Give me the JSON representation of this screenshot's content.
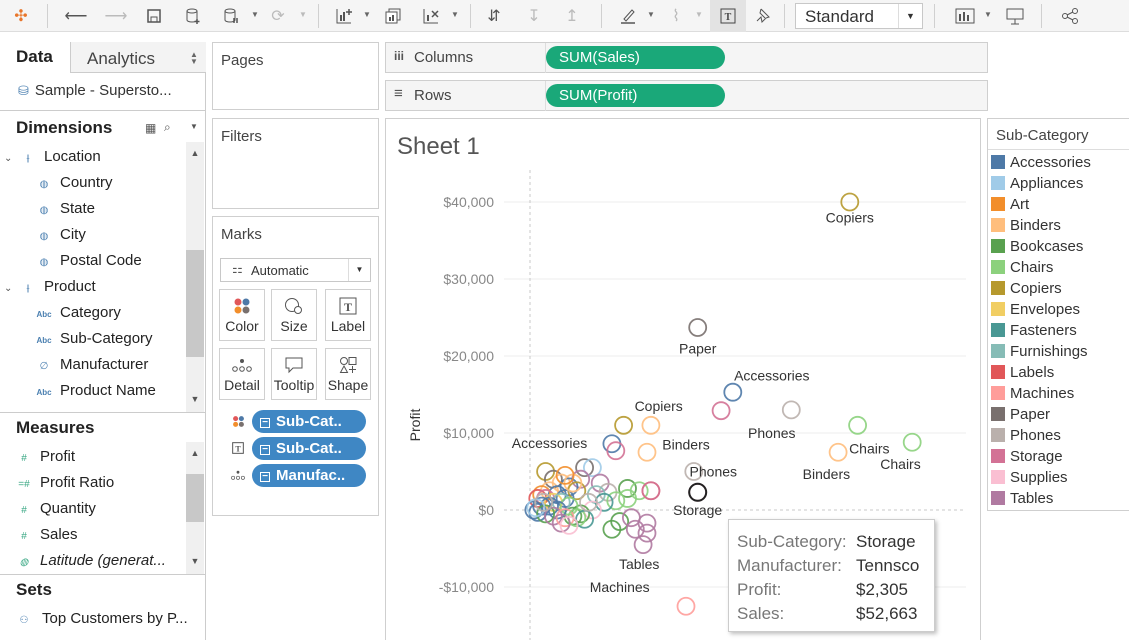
{
  "toolbar": {
    "view_mode": "Standard"
  },
  "left_panel": {
    "tabs": [
      {
        "label": "Data"
      },
      {
        "label": "Analytics"
      }
    ],
    "datasource": "Sample - Supersto...",
    "dimensions_title": "Dimensions",
    "dimensions": [
      {
        "label": "Location",
        "kind": "group"
      },
      {
        "label": "Country",
        "kind": "geo"
      },
      {
        "label": "State",
        "kind": "geo"
      },
      {
        "label": "City",
        "kind": "geo"
      },
      {
        "label": "Postal Code",
        "kind": "geo"
      },
      {
        "label": "Product",
        "kind": "group"
      },
      {
        "label": "Category",
        "kind": "abc"
      },
      {
        "label": "Sub-Category",
        "kind": "abc"
      },
      {
        "label": "Manufacturer",
        "kind": "link"
      },
      {
        "label": "Product Name",
        "kind": "abc"
      }
    ],
    "measures_title": "Measures",
    "measures": [
      {
        "label": "Profit"
      },
      {
        "label": "Profit Ratio"
      },
      {
        "label": "Quantity"
      },
      {
        "label": "Sales"
      },
      {
        "label": "Latitude (generat..."
      }
    ],
    "sets_title": "Sets",
    "sets": [
      {
        "label": "Top Customers by P..."
      }
    ]
  },
  "shelves": {
    "pages": "Pages",
    "filters": "Filters",
    "columns_label": "Columns",
    "columns_pill": "SUM(Sales)",
    "rows_label": "Rows",
    "rows_pill": "SUM(Profit)"
  },
  "marks": {
    "title": "Marks",
    "type": "Automatic",
    "buttons": [
      "Color",
      "Size",
      "Label",
      "Detail",
      "Tooltip",
      "Shape"
    ],
    "pills": [
      "Sub-Cat..",
      "Sub-Cat..",
      "Manufac.."
    ]
  },
  "sheet": {
    "title": "Sheet 1"
  },
  "legend": {
    "title": "Sub-Category",
    "items": [
      {
        "label": "Accessories",
        "color": "#4e79a7"
      },
      {
        "label": "Appliances",
        "color": "#a0cbe8"
      },
      {
        "label": "Art",
        "color": "#f28e2b"
      },
      {
        "label": "Binders",
        "color": "#ffbe7d"
      },
      {
        "label": "Bookcases",
        "color": "#59a14f"
      },
      {
        "label": "Chairs",
        "color": "#8cd17d"
      },
      {
        "label": "Copiers",
        "color": "#b6992d"
      },
      {
        "label": "Envelopes",
        "color": "#f1ce63"
      },
      {
        "label": "Fasteners",
        "color": "#499894"
      },
      {
        "label": "Furnishings",
        "color": "#86bcb6"
      },
      {
        "label": "Labels",
        "color": "#e15759"
      },
      {
        "label": "Machines",
        "color": "#ff9d9a"
      },
      {
        "label": "Paper",
        "color": "#79706e"
      },
      {
        "label": "Phones",
        "color": "#bab0ac"
      },
      {
        "label": "Storage",
        "color": "#d37295"
      },
      {
        "label": "Supplies",
        "color": "#fabfd2"
      },
      {
        "label": "Tables",
        "color": "#b07aa1"
      }
    ]
  },
  "tooltip": {
    "rows": [
      {
        "key": "Sub-Category:",
        "value": "Storage"
      },
      {
        "key": "Manufacturer:",
        "value": "Tennsco"
      },
      {
        "key": "Profit:",
        "value": "$2,305"
      },
      {
        "key": "Sales:",
        "value": "$52,663"
      }
    ]
  },
  "chart_data": {
    "type": "scatter",
    "title": "Sheet 1",
    "xlabel": "",
    "ylabel": "Profit",
    "ylim": [
      -15000,
      42000
    ],
    "y_ticks": [
      "$40,000",
      "$30,000",
      "$20,000",
      "$10,000",
      "$0",
      "-$10,000"
    ],
    "y_tick_values": [
      40000,
      30000,
      20000,
      10000,
      0,
      -10000
    ],
    "annotations": [
      {
        "text": "Copiers",
        "x": 82000,
        "y": 38000
      },
      {
        "text": "Paper",
        "x": 43000,
        "y": 21000
      },
      {
        "text": "Accessories",
        "x": 62000,
        "y": 17500
      },
      {
        "text": "Copiers",
        "x": 33000,
        "y": 13500
      },
      {
        "text": "Phones",
        "x": 62000,
        "y": 10000
      },
      {
        "text": "Chairs",
        "x": 87000,
        "y": 8000
      },
      {
        "text": "Accessories",
        "x": 5000,
        "y": 8700
      },
      {
        "text": "Binders",
        "x": 40000,
        "y": 8500
      },
      {
        "text": "Phones",
        "x": 47000,
        "y": 5000
      },
      {
        "text": "Binders",
        "x": 76000,
        "y": 4700
      },
      {
        "text": "Chairs",
        "x": 95000,
        "y": 6000
      },
      {
        "text": "Storage",
        "x": 43000,
        "y": 0
      },
      {
        "text": "Tables",
        "x": 28000,
        "y": -7000
      },
      {
        "text": "Machines",
        "x": 23000,
        "y": -10000
      }
    ],
    "points": [
      {
        "x": 82000,
        "y": 40000,
        "cat": "Copiers"
      },
      {
        "x": 43000,
        "y": 23700,
        "cat": "Paper"
      },
      {
        "x": 52000,
        "y": 15300,
        "cat": "Accessories"
      },
      {
        "x": 49000,
        "y": 12900,
        "cat": "Storage"
      },
      {
        "x": 67000,
        "y": 13000,
        "cat": "Phones"
      },
      {
        "x": 84000,
        "y": 11000,
        "cat": "Chairs"
      },
      {
        "x": 98000,
        "y": 8800,
        "cat": "Chairs"
      },
      {
        "x": 79000,
        "y": 7500,
        "cat": "Binders"
      },
      {
        "x": 24000,
        "y": 11000,
        "cat": "Copiers"
      },
      {
        "x": 31000,
        "y": 11000,
        "cat": "Binders"
      },
      {
        "x": 21000,
        "y": 8600,
        "cat": "Accessories"
      },
      {
        "x": 22000,
        "y": 7700,
        "cat": "Storage"
      },
      {
        "x": 30000,
        "y": 7500,
        "cat": "Binders"
      },
      {
        "x": 42000,
        "y": 5000,
        "cat": "Phones"
      },
      {
        "x": 43000,
        "y": 2300,
        "cat": "Storage"
      },
      {
        "x": 14000,
        "y": 5500,
        "cat": "Paper"
      },
      {
        "x": 16000,
        "y": 5500,
        "cat": "Appliances"
      },
      {
        "x": 13000,
        "y": 4000,
        "cat": "Tables"
      },
      {
        "x": 18000,
        "y": 3500,
        "cat": "Tables"
      },
      {
        "x": 25000,
        "y": 2800,
        "cat": "Bookcases"
      },
      {
        "x": 28000,
        "y": 2500,
        "cat": "Chairs"
      },
      {
        "x": 31000,
        "y": 2500,
        "cat": "Labels"
      },
      {
        "x": 31000,
        "y": 2500,
        "cat": "Storage"
      },
      {
        "x": 20000,
        "y": 2300,
        "cat": "Phones"
      },
      {
        "x": 17000,
        "y": 2000,
        "cat": "Furnishings"
      },
      {
        "x": 22000,
        "y": 1200,
        "cat": "Chairs"
      },
      {
        "x": 25000,
        "y": 1500,
        "cat": "Chairs"
      },
      {
        "x": 19000,
        "y": 1000,
        "cat": "Fasteners"
      },
      {
        "x": 16000,
        "y": 0,
        "cat": "Supplies"
      },
      {
        "x": 13000,
        "y": -500,
        "cat": "Bookcases"
      },
      {
        "x": 11000,
        "y": -800,
        "cat": "Bookcases"
      },
      {
        "x": 23000,
        "y": -1500,
        "cat": "Bookcases"
      },
      {
        "x": 26000,
        "y": -1000,
        "cat": "Tables"
      },
      {
        "x": 27000,
        "y": -2500,
        "cat": "Tables"
      },
      {
        "x": 30000,
        "y": -3000,
        "cat": "Tables"
      },
      {
        "x": 30000,
        "y": -1700,
        "cat": "Tables"
      },
      {
        "x": 29000,
        "y": -4500,
        "cat": "Tables"
      },
      {
        "x": 21000,
        "y": -2500,
        "cat": "Bookcases"
      },
      {
        "x": 40000,
        "y": -12500,
        "cat": "Machines"
      },
      {
        "x": 4000,
        "y": 5000,
        "cat": "Copiers"
      },
      {
        "x": 6000,
        "y": 4000,
        "cat": "Paper"
      },
      {
        "x": 8000,
        "y": 3500,
        "cat": "Binders"
      },
      {
        "x": 10000,
        "y": 3000,
        "cat": "Accessories"
      },
      {
        "x": 12000,
        "y": 2500,
        "cat": "Copiers"
      },
      {
        "x": 5000,
        "y": 2500,
        "cat": "Binders"
      },
      {
        "x": 7000,
        "y": 2000,
        "cat": "Accessories"
      },
      {
        "x": 3000,
        "y": 2000,
        "cat": "Art"
      },
      {
        "x": 9000,
        "y": 1500,
        "cat": "Accessories"
      },
      {
        "x": 2000,
        "y": 1500,
        "cat": "Labels"
      },
      {
        "x": 4000,
        "y": 1500,
        "cat": "Storage"
      },
      {
        "x": 6000,
        "y": 1000,
        "cat": "Envelopes"
      },
      {
        "x": 8000,
        "y": 1000,
        "cat": "Furnishings"
      },
      {
        "x": 10000,
        "y": 500,
        "cat": "Chairs"
      },
      {
        "x": 3000,
        "y": 500,
        "cat": "Accessories"
      },
      {
        "x": 5000,
        "y": 500,
        "cat": "Accessories"
      },
      {
        "x": 7000,
        "y": 0,
        "cat": "Accessories"
      },
      {
        "x": 1000,
        "y": 0,
        "cat": "Accessories"
      },
      {
        "x": 2000,
        "y": -300,
        "cat": "Accessories"
      },
      {
        "x": 4000,
        "y": -500,
        "cat": "Bookcases"
      },
      {
        "x": 6000,
        "y": -800,
        "cat": "Tables"
      },
      {
        "x": 9000,
        "y": -1000,
        "cat": "Machines"
      },
      {
        "x": 12000,
        "y": -1000,
        "cat": "Chairs"
      },
      {
        "x": 14000,
        "y": -1200,
        "cat": "Fasteners"
      },
      {
        "x": 8000,
        "y": -1700,
        "cat": "Tables"
      },
      {
        "x": 10000,
        "y": -2000,
        "cat": "Supplies"
      },
      {
        "x": 1500,
        "y": 300,
        "cat": "Appliances"
      },
      {
        "x": 3500,
        "y": 1000,
        "cat": "Phones"
      },
      {
        "x": 11000,
        "y": 3500,
        "cat": "Binders"
      },
      {
        "x": 9000,
        "y": 4500,
        "cat": "Art"
      },
      {
        "x": 15000,
        "y": 1000,
        "cat": "Phones"
      }
    ]
  }
}
